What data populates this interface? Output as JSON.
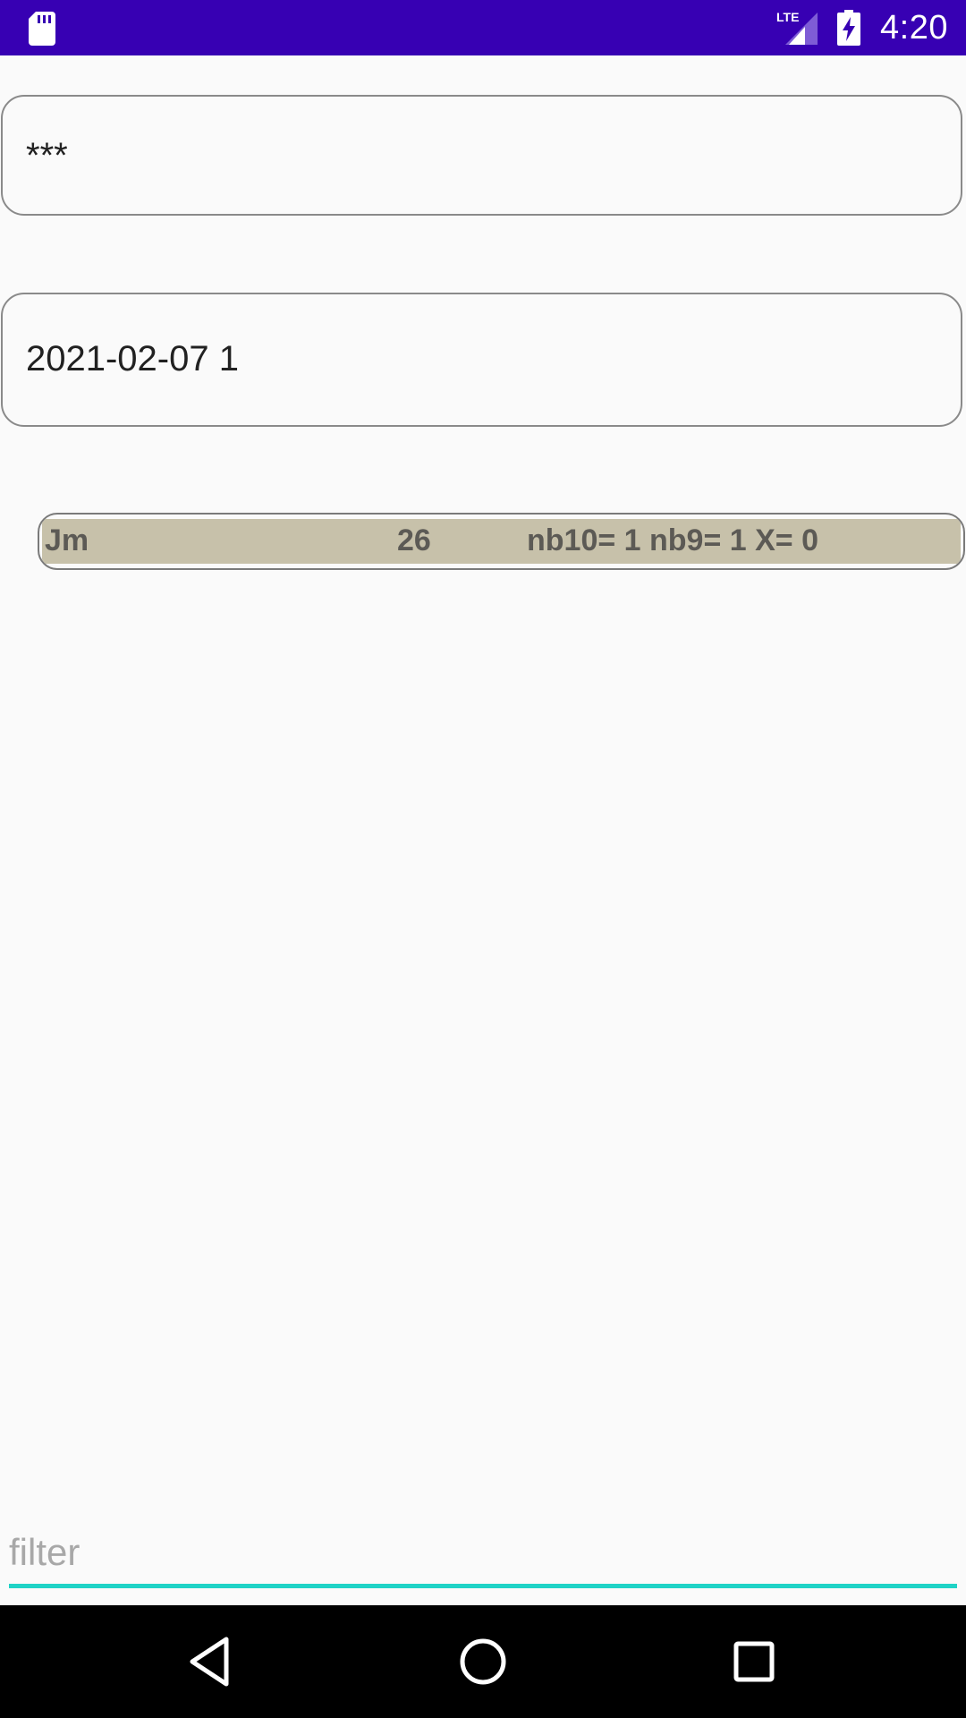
{
  "status_bar": {
    "time": "4:20",
    "network_label": "LTE",
    "icons": [
      "sd-card-icon",
      "lte-signal-icon",
      "battery-charging-icon"
    ],
    "background_color": "#3700b3"
  },
  "fields": {
    "first_value": "***",
    "second_value": "2021-02-07 1"
  },
  "list": {
    "rows": [
      {
        "name": "Jm",
        "count": "26",
        "stats": "nb10= 1 nb9= 1 X= 0"
      }
    ],
    "row_color": "#c7c1aa"
  },
  "filter": {
    "placeholder": "filter",
    "value": "",
    "accent_color": "#1fd3c6"
  },
  "nav_bar": {
    "icons": [
      "back-icon",
      "home-icon",
      "recents-icon"
    ]
  }
}
